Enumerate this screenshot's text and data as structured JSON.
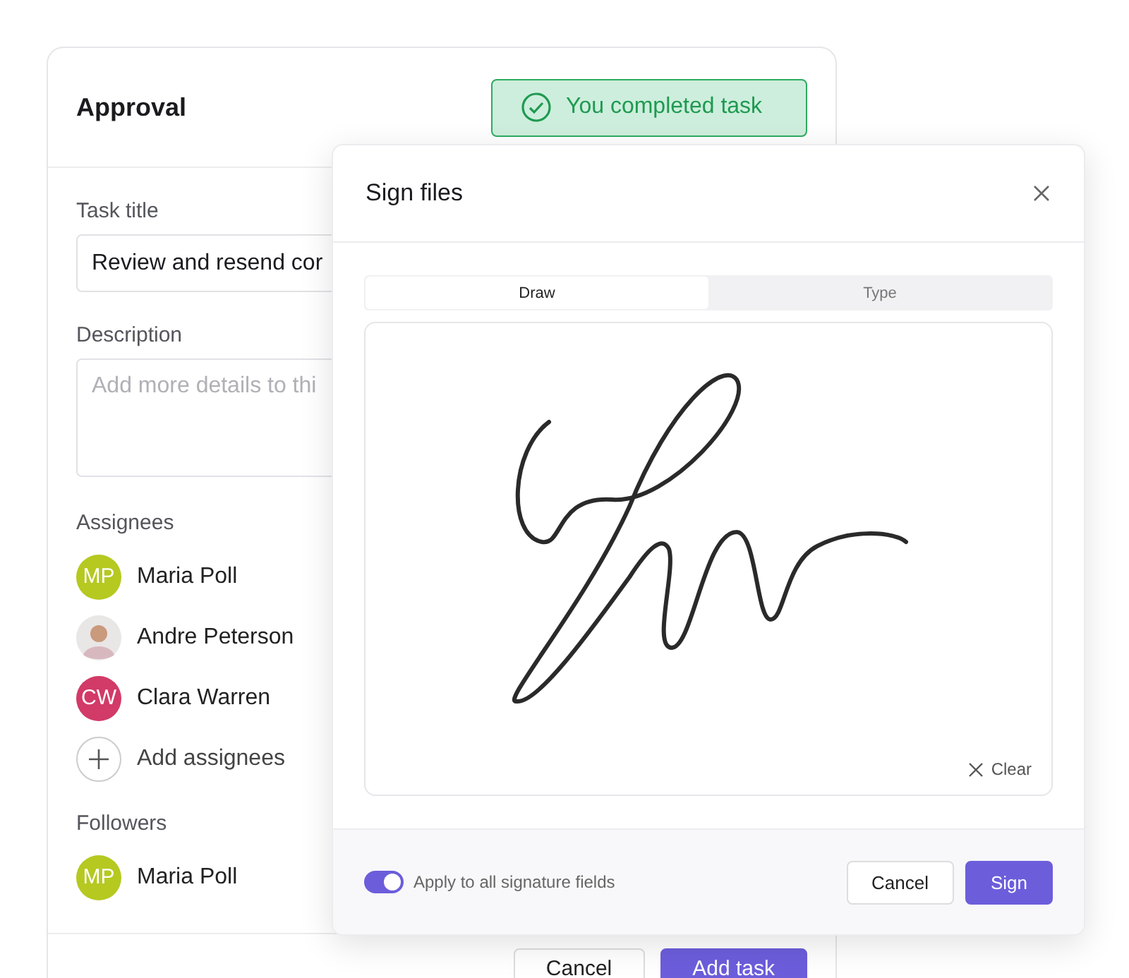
{
  "approval": {
    "title": "Approval",
    "badge": "You completed task",
    "task_title": {
      "label": "Task title",
      "value": "Review and resend cor"
    },
    "description": {
      "label": "Description",
      "placeholder": "Add more details to thi"
    },
    "assignees": {
      "label": "Assignees",
      "people": [
        {
          "kind": "initials",
          "initials": "MP",
          "name": "Maria Poll",
          "color": "#b5c920"
        },
        {
          "name": "Andre Peterson"
        },
        {
          "kind": "initials",
          "initials": "CW",
          "name": "Clara Warren",
          "color": "#d23a68"
        }
      ],
      "add": "Add assignees"
    },
    "followers": {
      "label": "Followers",
      "people": [
        {
          "kind": "initials",
          "initials": "MP",
          "name": "Maria Poll",
          "color": "#b5c920"
        }
      ]
    },
    "buttons": [
      {
        "kind": "secondary",
        "label": "Cancel"
      },
      {
        "kind": "primary",
        "label": "Add task"
      }
    ]
  },
  "dialog": {
    "title": "Sign files",
    "tabs": [
      {
        "label": "Draw",
        "selected": true
      },
      {
        "label": "Type",
        "selected": false
      }
    ],
    "clear": "Clear",
    "apply_all": {
      "label": "Apply to all signature fields",
      "on": true
    },
    "buttons": [
      {
        "kind": "secondary",
        "label": "Cancel"
      },
      {
        "kind": "primary",
        "label": "Sign"
      }
    ]
  }
}
